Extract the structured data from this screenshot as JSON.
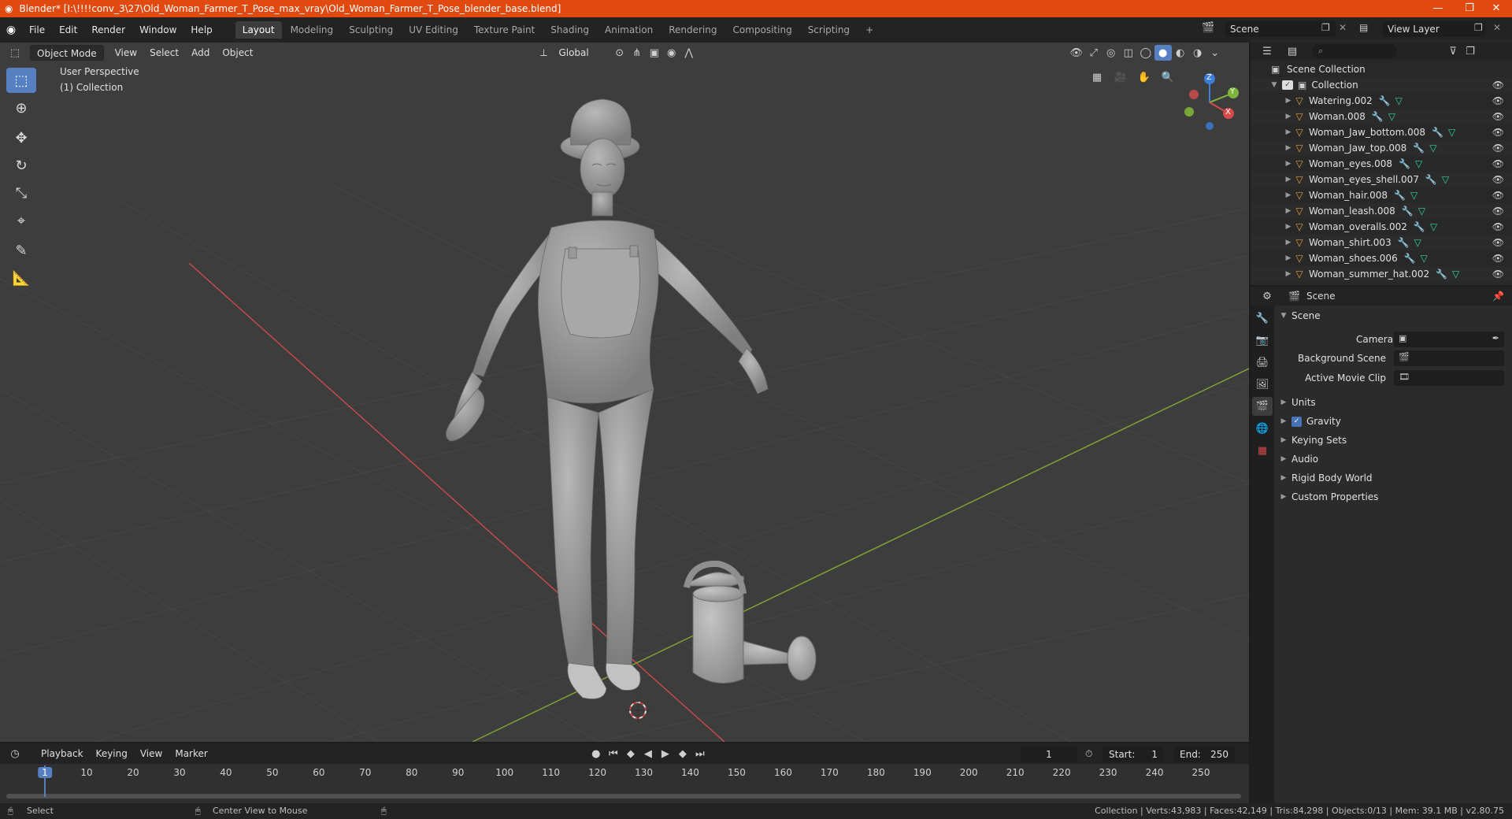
{
  "window": {
    "title": "Blender* [I:\\!!!!conv_3\\27\\Old_Woman_Farmer_T_Pose_max_vray\\Old_Woman_Farmer_T_Pose_blender_base.blend]",
    "minimize": "—",
    "maximize": "❐",
    "close": "✕"
  },
  "menu": [
    "File",
    "Edit",
    "Render",
    "Window",
    "Help"
  ],
  "workspaces": {
    "tabs": [
      "Layout",
      "Modeling",
      "Sculpting",
      "UV Editing",
      "Texture Paint",
      "Shading",
      "Animation",
      "Rendering",
      "Compositing",
      "Scripting"
    ],
    "active": "Layout",
    "add": "+"
  },
  "scene_selector": {
    "label": "Scene"
  },
  "view_layer_selector": {
    "label": "View Layer"
  },
  "viewport_header": {
    "mode": "Object Mode",
    "menus": [
      "View",
      "Select",
      "Add",
      "Object"
    ],
    "orientation": "Global"
  },
  "viewport": {
    "perspective_label": "User Perspective",
    "collection_label": "(1) Collection",
    "gizmo": {
      "x": "X",
      "y": "Y",
      "z": "Z"
    }
  },
  "tools": [
    "select-box",
    "cursor",
    "move",
    "rotate",
    "scale",
    "transform",
    "annotate",
    "measure"
  ],
  "outliner": {
    "root": "Scene Collection",
    "collection": "Collection",
    "objects": [
      "Watering.002",
      "Woman.008",
      "Woman_Jaw_bottom.008",
      "Woman_Jaw_top.008",
      "Woman_eyes.008",
      "Woman_eyes_shell.007",
      "Woman_hair.008",
      "Woman_leash.008",
      "Woman_overalls.002",
      "Woman_shirt.003",
      "Woman_shoes.006",
      "Woman_summer_hat.002"
    ]
  },
  "properties": {
    "header": "Scene",
    "panel": "Scene",
    "fields": {
      "camera": "Camera",
      "background_scene": "Background Scene",
      "active_movie_clip": "Active Movie Clip"
    },
    "subpanels": [
      "Units",
      "Gravity",
      "Keying Sets",
      "Audio",
      "Rigid Body World",
      "Custom Properties"
    ],
    "gravity_checked": true
  },
  "timeline": {
    "menus": [
      "Playback",
      "Keying",
      "View",
      "Marker"
    ],
    "current_frame": "1",
    "start_label": "Start:",
    "start": "1",
    "end_label": "End:",
    "end": "250",
    "ruler": [
      "1",
      "10",
      "20",
      "30",
      "40",
      "50",
      "60",
      "70",
      "80",
      "90",
      "100",
      "110",
      "120",
      "130",
      "140",
      "150",
      "160",
      "170",
      "180",
      "190",
      "200",
      "210",
      "220",
      "230",
      "240",
      "250"
    ]
  },
  "status": {
    "left_action": "Select",
    "middle_action": "Center View to Mouse",
    "stats": "Collection | Verts:43,983 | Faces:42,149 | Tris:84,298 | Objects:0/13 | Mem: 39.1 MB | v2.80.75"
  },
  "colors": {
    "titlebar": "#e04a10",
    "viewport_bg": "#3d3d3d",
    "x_axis": "#c44a4a",
    "y_axis": "#7fa035",
    "selection": "#5680c2",
    "object_icon": "#e89a3c"
  }
}
